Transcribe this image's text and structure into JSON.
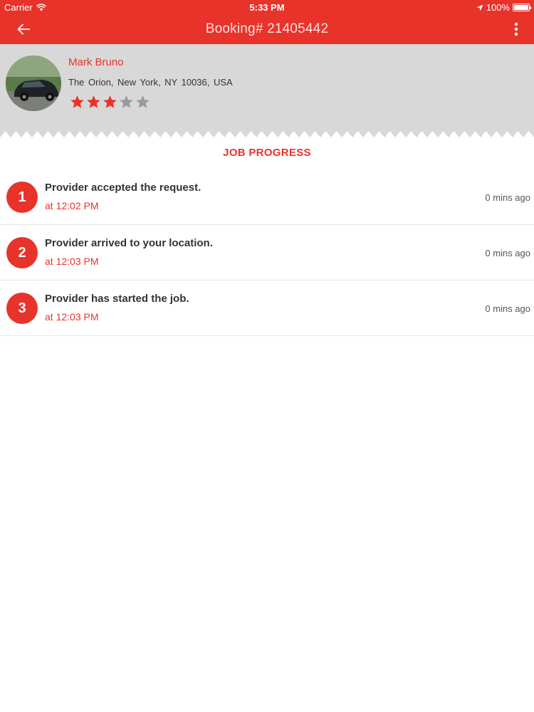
{
  "status_bar": {
    "carrier": "Carrier",
    "time": "5:33 PM",
    "battery": "100%"
  },
  "nav": {
    "title": "Booking# 21405442"
  },
  "profile": {
    "name": "Mark Bruno",
    "address": "The Orion, New York, NY 10036, USA",
    "rating": 3,
    "rating_max": 5
  },
  "job_progress": {
    "title": "JOB PROGRESS",
    "steps": [
      {
        "number": "1",
        "title": "Provider accepted the request.",
        "time": "at 12:02 PM",
        "ago": "0 mins ago"
      },
      {
        "number": "2",
        "title": "Provider arrived to your location.",
        "time": "at 12:03 PM",
        "ago": "0 mins ago"
      },
      {
        "number": "3",
        "title": "Provider has started the job.",
        "time": "at 12:03 PM",
        "ago": "0 mins ago"
      }
    ]
  },
  "colors": {
    "accent": "#e8332b",
    "header_bg": "#d8d8d8",
    "star_filled": "#e8332b",
    "star_empty": "#9a9a9a"
  }
}
